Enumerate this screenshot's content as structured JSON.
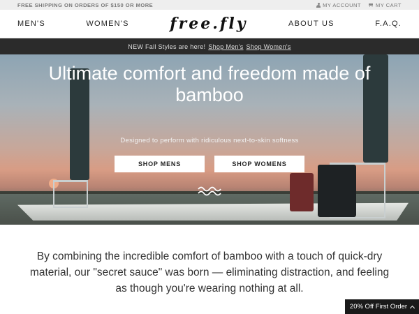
{
  "topbar": {
    "shipping_text": "FREE SHIPPING ON ORDERS OF $150 OR MORE",
    "account_label": "MY ACCOUNT",
    "cart_label": "MY CART"
  },
  "nav": {
    "mens": "MEN'S",
    "womens": "WOMEN'S",
    "logo_text": "free.fly",
    "about": "ABOUT US",
    "faq": "F.A.Q."
  },
  "announcement": {
    "text": "NEW Fall Styles are here!",
    "mens_link": "Shop Men's",
    "womens_link": "Shop Women's"
  },
  "hero": {
    "headline": "Ultimate comfort and freedom made of bamboo",
    "subheadline": "Designed to perform with ridiculous next-to-skin softness",
    "shop_mens": "SHOP MENS",
    "shop_womens": "SHOP WOMENS"
  },
  "body": {
    "copy": "By combining the incredible comfort of bamboo with a touch of quick-dry material, our \"secret sauce\" was born — eliminating distraction, and feeling as though you're wearing nothing at all."
  },
  "promo": {
    "label": "20% Off First Order"
  }
}
